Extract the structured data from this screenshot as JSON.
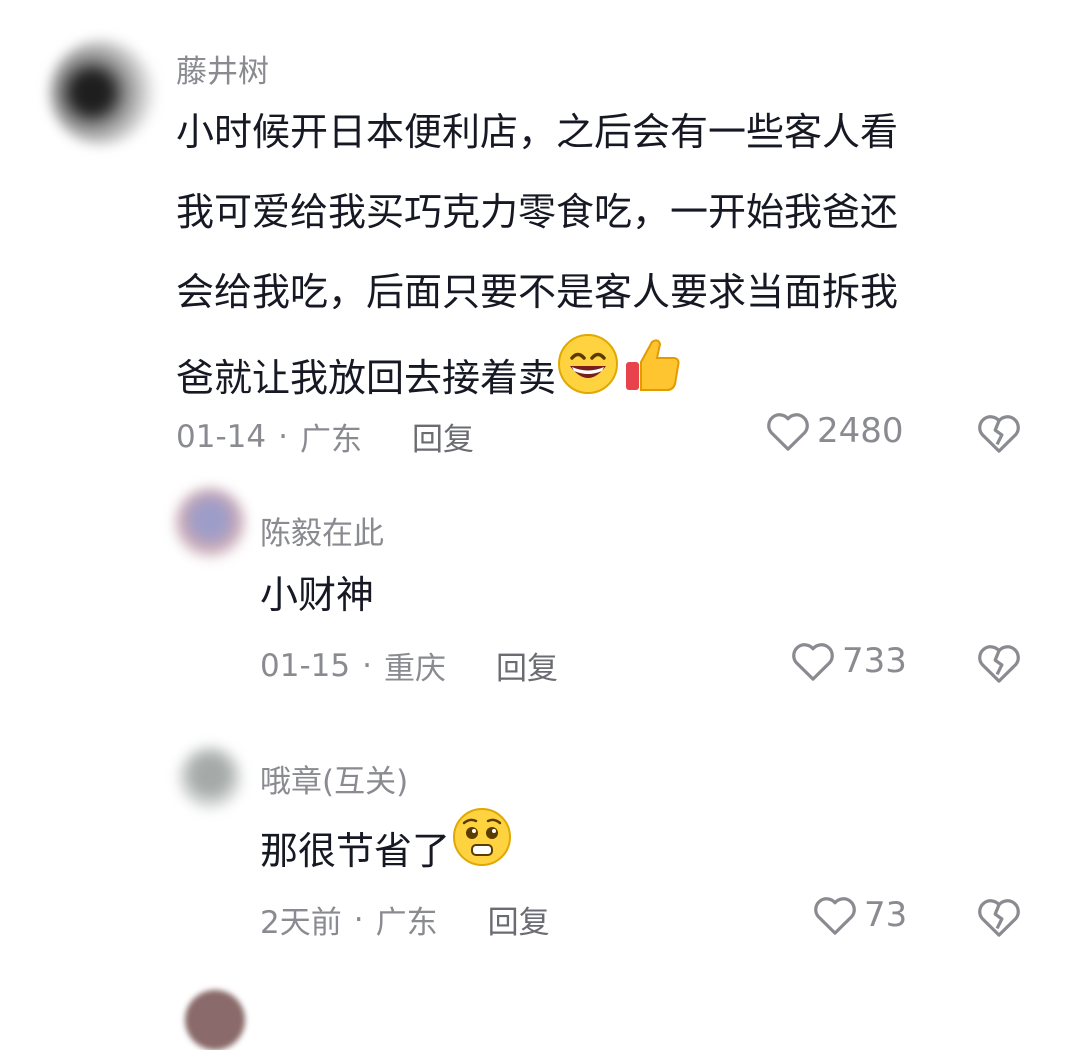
{
  "comments": [
    {
      "username": "藤井树",
      "text_lines": [
        "小时候开日本便利店，之后会有一些客人看",
        "我可爱给我买巧克力零食吃，一开始我爸还",
        "会给我吃，后面只要不是客人要求当面拆我",
        "爸就让我放回去接着卖"
      ],
      "emojis": [
        "grinning-face",
        "thumbs-up"
      ],
      "date": "01-14",
      "location": "广东",
      "reply_label": "回复",
      "likes": "2480",
      "replies": [
        {
          "username": "陈毅在此",
          "text": "小财神",
          "date": "01-15",
          "location": "重庆",
          "reply_label": "回复",
          "likes": "733"
        },
        {
          "username": "哦章(互关)",
          "text": "那很节省了",
          "emoji": "pleading-face",
          "date": "2天前",
          "location": "广东",
          "reply_label": "回复",
          "likes": "73"
        }
      ]
    }
  ],
  "separator": "·",
  "colors": {
    "text": "#161823",
    "secondary": "#8a8b91",
    "background": "#ffffff"
  },
  "icons": [
    "heart-outline-icon",
    "broken-heart-icon"
  ]
}
